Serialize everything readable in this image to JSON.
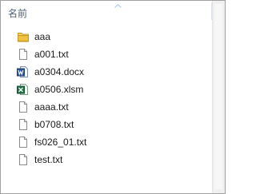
{
  "header": {
    "column_name": "名前",
    "sort_indicator": "ascending"
  },
  "files": [
    {
      "name": "aaa",
      "icon": "folder-icon"
    },
    {
      "name": "a001.txt",
      "icon": "text-file-icon"
    },
    {
      "name": "a0304.docx",
      "icon": "word-file-icon"
    },
    {
      "name": "a0506.xlsm",
      "icon": "excel-file-icon"
    },
    {
      "name": "aaaa.txt",
      "icon": "text-file-icon"
    },
    {
      "name": "b0708.txt",
      "icon": "text-file-icon"
    },
    {
      "name": "fs026_01.txt",
      "icon": "text-file-icon"
    },
    {
      "name": "test.txt",
      "icon": "text-file-icon"
    }
  ],
  "colors": {
    "header_text": "#4c607a",
    "item_text": "#1a1a1a",
    "folder": "#e8b93a",
    "word": "#2b579a",
    "excel": "#217346",
    "border": "#a0a0a0"
  }
}
